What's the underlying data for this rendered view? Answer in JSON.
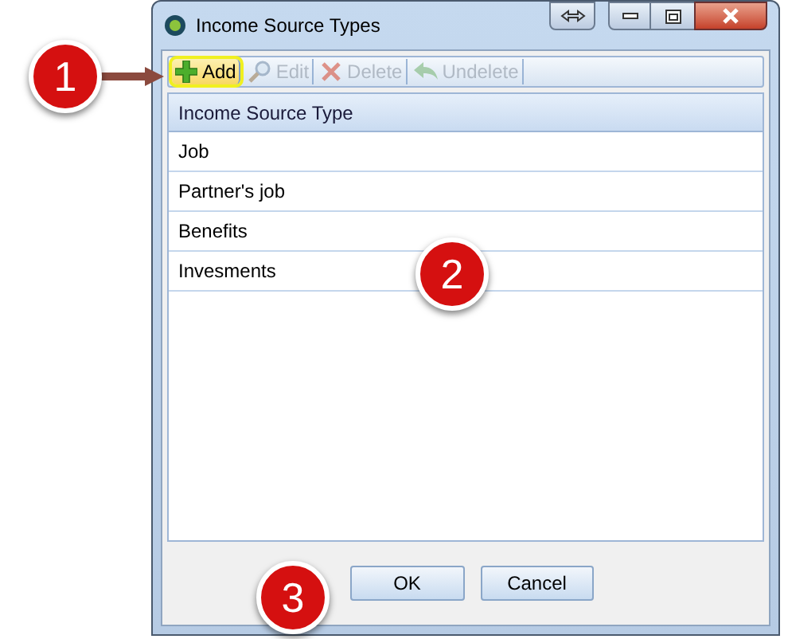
{
  "window": {
    "title": "Income Source Types"
  },
  "toolbar": [
    {
      "kind": "add",
      "label": "Add",
      "disabled": false,
      "highlighted": true
    },
    {
      "kind": "edit",
      "label": "Edit",
      "disabled": true,
      "highlighted": false
    },
    {
      "kind": "delete",
      "label": "Delete",
      "disabled": true,
      "highlighted": false
    },
    {
      "kind": "undelete",
      "label": "Undelete",
      "disabled": true,
      "highlighted": false
    }
  ],
  "table": {
    "columns": [
      "Income Source Type"
    ],
    "rows": [
      [
        "Job"
      ],
      [
        "Partner's job"
      ],
      [
        "Benefits"
      ],
      [
        "Invesments"
      ]
    ]
  },
  "buttons": [
    "OK",
    "Cancel"
  ],
  "callouts": [
    {
      "label": "1"
    },
    {
      "label": "2"
    },
    {
      "label": "3"
    }
  ]
}
